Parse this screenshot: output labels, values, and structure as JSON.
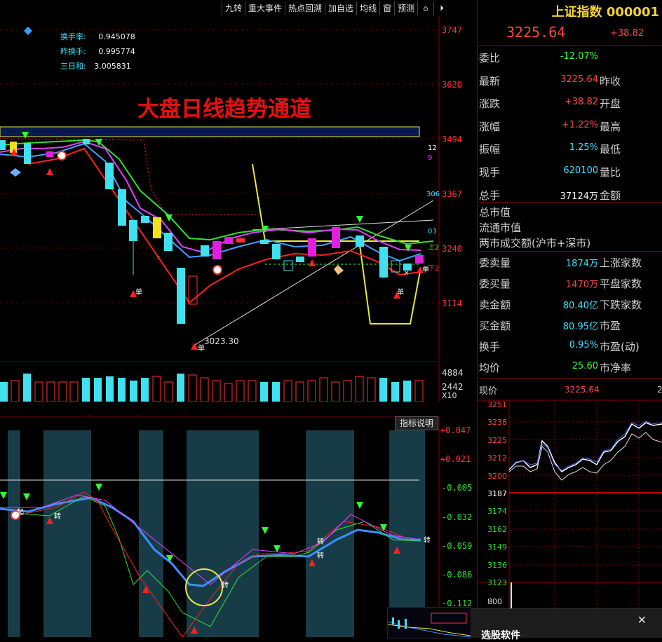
{
  "toolbar": {
    "items": [
      "九转",
      "重大事件",
      "热点回溯",
      "加自选",
      "均线",
      "窗",
      "预测"
    ]
  },
  "main_chart": {
    "title": "大盘日线趋势通道",
    "info": [
      {
        "label": "换手率:",
        "value": "0.945078"
      },
      {
        "label": "昨换手:",
        "value": "0.995774"
      },
      {
        "label": "三日和:",
        "value": "3.005831"
      }
    ],
    "price_axis": [
      "3747",
      "3620",
      "3494",
      "3367",
      "3240",
      "3114"
    ],
    "low_label": "3023.30",
    "right_marks": [
      "12",
      "9",
      "306",
      "03",
      "上2",
      "下2"
    ],
    "signal_labels": {
      "buy": "单",
      "turn": "转"
    }
  },
  "volume_chart": {
    "axis": [
      "4884",
      "2442",
      "X10"
    ]
  },
  "indicator_chart": {
    "button": "指标说明",
    "axis": [
      "+0.047",
      "+0.021",
      "-0.005",
      "-0.032",
      "-0.059",
      "-0.086",
      "-0.112"
    ],
    "labels": [
      "起",
      "转",
      "转",
      "转",
      "转",
      "转"
    ]
  },
  "right_panel": {
    "name": "上证指数",
    "code": "000001",
    "price": "3225.64",
    "change": "+38.82",
    "rows": [
      {
        "label": "委比",
        "value": "-12.07%",
        "value_color": "green",
        "label2": ""
      },
      {
        "label": "最新",
        "value": "3225.64",
        "value_color": "red",
        "label2": "昨收"
      },
      {
        "label": "涨跌",
        "value": "+38.82",
        "value_color": "red",
        "label2": "开盘"
      },
      {
        "label": "涨幅",
        "value": "+1.22%",
        "value_color": "red",
        "label2": "最高"
      },
      {
        "label": "振幅",
        "value": "1.25%",
        "value_color": "cyan",
        "label2": "最低"
      },
      {
        "label": "现手",
        "value": "620100",
        "value_color": "cyan",
        "label2": "量比"
      },
      {
        "label": "总手",
        "value": "37124万",
        "value_color": "white",
        "label2": "金额"
      }
    ],
    "cap_rows": [
      "总市值",
      "流通市值",
      "两市成交额(沪市+深市)"
    ],
    "rows2": [
      {
        "label": "委卖量",
        "value": "1874万",
        "value_color": "cyan",
        "label2": "上涨家数"
      },
      {
        "label": "委买量",
        "value": "1470万",
        "value_color": "red",
        "label2": "平盘家数"
      },
      {
        "label": "卖金额",
        "value": "80.40亿",
        "value_color": "cyan",
        "label2": "下跌家数"
      },
      {
        "label": "买金额",
        "value": "80.95亿",
        "value_color": "cyan",
        "label2": "市盈"
      },
      {
        "label": "换手",
        "value": "0.95%",
        "value_color": "cyan",
        "label2": "市盈(动)"
      },
      {
        "label": "均价",
        "value": "25.60",
        "value_color": "green",
        "label2": "市净率"
      }
    ],
    "mini": {
      "label": "现价",
      "price": "3225.64",
      "trail": "2",
      "axis": [
        "3251",
        "3238",
        "3225",
        "3212",
        "3200",
        "3187",
        "3174",
        "3162",
        "3149",
        "3136",
        "3123",
        "800"
      ]
    }
  },
  "popup": {
    "title": "选股软件",
    "close": "✕"
  }
}
